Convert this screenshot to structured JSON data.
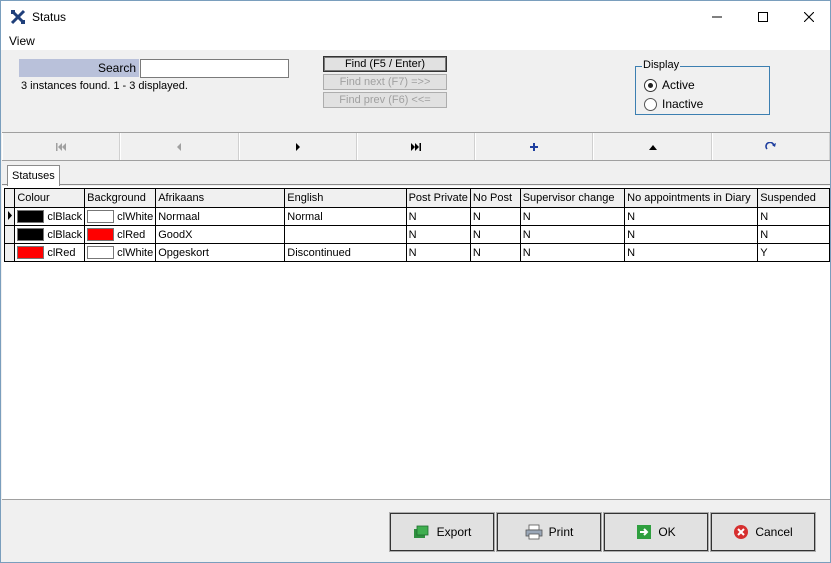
{
  "window": {
    "title": "Status",
    "icon": "tools-icon"
  },
  "menu": {
    "items": [
      {
        "label": "View"
      }
    ]
  },
  "search": {
    "label": "Search",
    "value": "",
    "found_text": "3 instances found.  1 - 3 displayed."
  },
  "find_buttons": [
    {
      "label": "Find (F5 / Enter)",
      "enabled": true
    },
    {
      "label": "Find next (F7) =>>",
      "enabled": false
    },
    {
      "label": "Find prev (F6) <<=",
      "enabled": false
    }
  ],
  "display": {
    "legend": "Display",
    "options": [
      {
        "label": "Active",
        "selected": true
      },
      {
        "label": "Inactive",
        "selected": false
      }
    ]
  },
  "navigator": [
    {
      "name": "first-record-icon",
      "enabled": false
    },
    {
      "name": "prior-record-icon",
      "enabled": false
    },
    {
      "name": "next-record-icon",
      "enabled": true
    },
    {
      "name": "last-record-icon",
      "enabled": true
    },
    {
      "name": "insert-record-icon",
      "enabled": true
    },
    {
      "name": "edit-record-icon",
      "enabled": true
    },
    {
      "name": "refresh-icon",
      "enabled": true
    }
  ],
  "tab": {
    "label": "Statuses"
  },
  "table": {
    "columns": [
      "Colour",
      "Background",
      "Afrikaans",
      "English",
      "Post Private",
      "No Post",
      "Supervisor change",
      "No appointments in Diary",
      "Suspended"
    ],
    "rows": [
      {
        "current": true,
        "colour": {
          "swatch": "#000000",
          "text": "clBlack"
        },
        "background": {
          "swatch": "#ffffff",
          "text": "clWhite"
        },
        "afrikaans": "Normaal",
        "english": "Normal",
        "post_private": "N",
        "no_post": "N",
        "supervisor_change": "N",
        "no_appointments": "N",
        "suspended": "N"
      },
      {
        "current": false,
        "colour": {
          "swatch": "#000000",
          "text": "clBlack"
        },
        "background": {
          "swatch": "#ff0000",
          "text": "clRed"
        },
        "afrikaans": "GoodX",
        "english": "",
        "post_private": "N",
        "no_post": "N",
        "supervisor_change": "N",
        "no_appointments": "N",
        "suspended": "N"
      },
      {
        "current": false,
        "colour": {
          "swatch": "#ff0000",
          "text": "clRed"
        },
        "background": {
          "swatch": "#ffffff",
          "text": "clWhite"
        },
        "afrikaans": "Opgeskort",
        "english": "Discontinued",
        "post_private": "N",
        "no_post": "N",
        "supervisor_change": "N",
        "no_appointments": "N",
        "suspended": "Y"
      }
    ]
  },
  "actions": {
    "export": "Export",
    "print": "Print",
    "ok": "OK",
    "cancel": "Cancel"
  },
  "colors": {
    "search_label_bg": "#b9c1da",
    "display_border": "#3c7fb1",
    "nav_blue": "#1f3f9f"
  }
}
